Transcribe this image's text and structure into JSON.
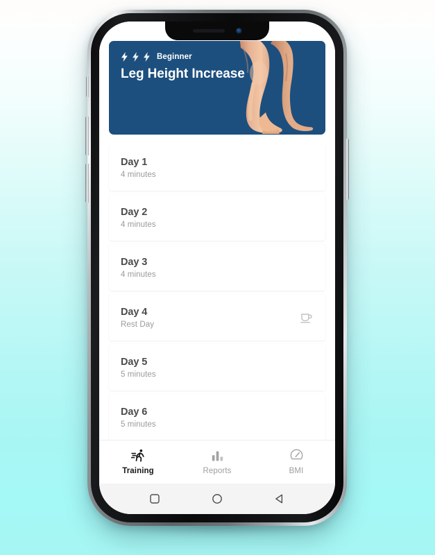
{
  "device": {
    "notch": {
      "speaker": "earpiece-speaker",
      "camera": "front-camera"
    },
    "buttons": [
      "silent-switch",
      "volume-up",
      "volume-down",
      "power"
    ]
  },
  "hero": {
    "level_label": "Beginner",
    "title": "Leg Height Increase",
    "bolt_count": 3,
    "bg_color": "#1c4f7e",
    "image_alt": "walking-legs-photo"
  },
  "day_list": [
    {
      "title": "Day 1",
      "subtitle": "4 minutes",
      "rest": false
    },
    {
      "title": "Day 2",
      "subtitle": "4 minutes",
      "rest": false
    },
    {
      "title": "Day 3",
      "subtitle": "4 minutes",
      "rest": false
    },
    {
      "title": "Day 4",
      "subtitle": "Rest Day",
      "rest": true
    },
    {
      "title": "Day 5",
      "subtitle": "5 minutes",
      "rest": false
    },
    {
      "title": "Day 6",
      "subtitle": "5 minutes",
      "rest": false
    }
  ],
  "bottom_nav": {
    "items": [
      {
        "label": "Training",
        "icon": "running-person-icon",
        "active": true
      },
      {
        "label": "Reports",
        "icon": "bar-chart-icon",
        "active": false
      },
      {
        "label": "BMI",
        "icon": "gauge-icon",
        "active": false
      }
    ],
    "active_color": "#161616",
    "inactive_color": "#9e9e9e"
  },
  "system_nav": {
    "buttons": [
      {
        "name": "recents-button",
        "icon": "square-icon"
      },
      {
        "name": "home-button",
        "icon": "circle-icon"
      },
      {
        "name": "back-button",
        "icon": "triangle-left-icon"
      }
    ]
  },
  "background": {
    "top_color": "#fffdfb",
    "bottom_color": "#a6f6f3"
  }
}
